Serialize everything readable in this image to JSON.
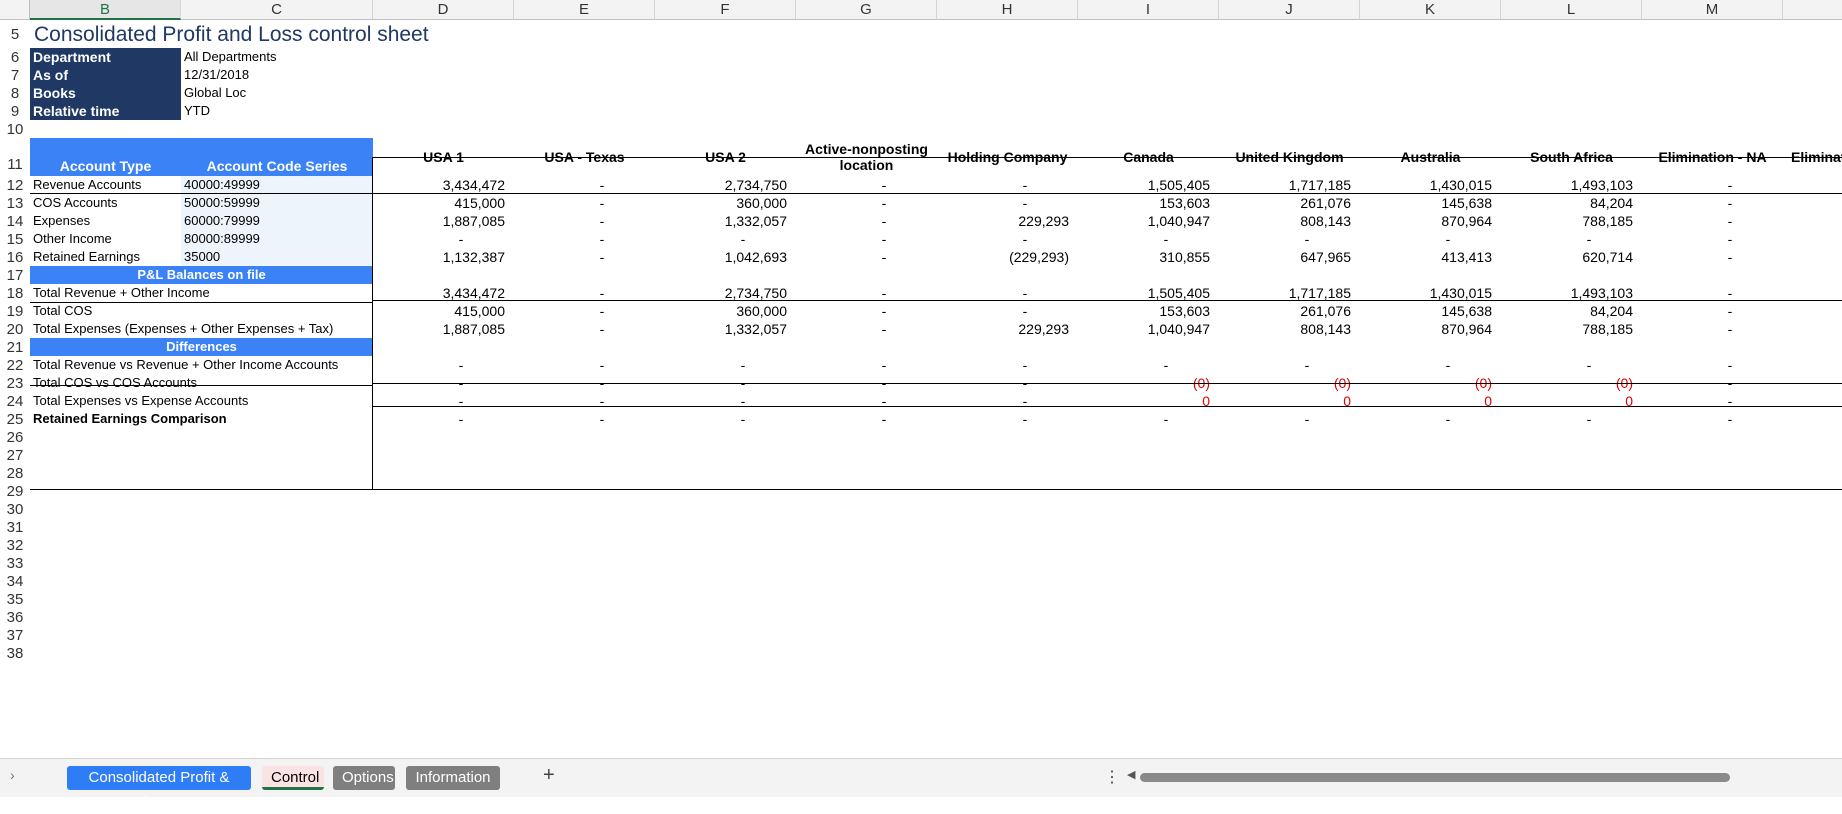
{
  "columns": [
    "B",
    "C",
    "D",
    "E",
    "F",
    "G",
    "H",
    "I",
    "J",
    "K",
    "L",
    "M"
  ],
  "active_column": "B",
  "rows": [
    "5",
    "6",
    "7",
    "8",
    "9",
    "10",
    "11",
    "12",
    "13",
    "14",
    "15",
    "16",
    "17",
    "18",
    "19",
    "20",
    "21",
    "22",
    "23",
    "24",
    "25",
    "26",
    "27",
    "28",
    "29",
    "30",
    "31",
    "32",
    "33",
    "34",
    "35",
    "36",
    "37",
    "38"
  ],
  "title": "Consolidated Profit and Loss control sheet",
  "params": [
    {
      "label": "Department",
      "value": "All Departments"
    },
    {
      "label": "As of",
      "value": "12/31/2018"
    },
    {
      "label": "Books",
      "value": "Global Loc"
    },
    {
      "label": "Relative time",
      "value": "YTD"
    }
  ],
  "headers": {
    "account_type": "Account Type",
    "account_code_series": "Account Code Series"
  },
  "entities": [
    "USA 1",
    "USA - Texas",
    "USA 2",
    "Active-nonposting location",
    "Holding Company",
    "Canada",
    "United Kingdom",
    "Australia",
    "South Africa",
    "Elimination - NA",
    "Eliminat"
  ],
  "accounts": [
    {
      "type": "Revenue Accounts",
      "code": "40000:49999",
      "values": [
        "3,434,472",
        "-",
        "2,734,750",
        "-",
        "-",
        "1,505,405",
        "1,717,185",
        "1,430,015",
        "1,493,103",
        "-"
      ]
    },
    {
      "type": "COS Accounts",
      "code": "50000:59999",
      "values": [
        "415,000",
        "-",
        "360,000",
        "-",
        "-",
        "153,603",
        "261,076",
        "145,638",
        "84,204",
        "-"
      ]
    },
    {
      "type": "Expenses",
      "code": "60000:79999",
      "values": [
        "1,887,085",
        "-",
        "1,332,057",
        "-",
        "229,293",
        "1,040,947",
        "808,143",
        "870,964",
        "788,185",
        "-"
      ]
    },
    {
      "type": "Other Income",
      "code": "80000:89999",
      "values": [
        "-",
        "-",
        "-",
        "-",
        "-",
        "-",
        "-",
        "-",
        "-",
        "-"
      ]
    },
    {
      "type": "Retained Earnings",
      "code": "35000",
      "values": [
        "1,132,387",
        "-",
        "1,042,693",
        "-",
        "(229,293)",
        "310,855",
        "647,965",
        "413,413",
        "620,714",
        "-"
      ]
    }
  ],
  "balances_header": "P&L Balances on file",
  "balances": [
    {
      "label": "Total Revenue + Other Income",
      "values": [
        "3,434,472",
        "-",
        "2,734,750",
        "-",
        "-",
        "1,505,405",
        "1,717,185",
        "1,430,015",
        "1,493,103",
        "-"
      ]
    },
    {
      "label": "Total COS",
      "values": [
        "415,000",
        "-",
        "360,000",
        "-",
        "-",
        "153,603",
        "261,076",
        "145,638",
        "84,204",
        "-"
      ]
    },
    {
      "label": "Total Expenses (Expenses + Other Expenses + Tax)",
      "values": [
        "1,887,085",
        "-",
        "1,332,057",
        "-",
        "229,293",
        "1,040,947",
        "808,143",
        "870,964",
        "788,185",
        "-"
      ]
    }
  ],
  "differences_header": "Differences",
  "differences": [
    {
      "label": "Total Revenue vs Revenue + Other Income Accounts",
      "bold": false,
      "values": [
        "-",
        "-",
        "-",
        "-",
        "-",
        "-",
        "-",
        "-",
        "-",
        "-"
      ]
    },
    {
      "label": "Total COS vs COS Accounts",
      "bold": false,
      "values": [
        "-",
        "-",
        "-",
        "-",
        "-",
        "(0)",
        "(0)",
        "(0)",
        "(0)",
        "-"
      ]
    },
    {
      "label": "Total Expenses vs Expense Accounts",
      "bold": false,
      "values": [
        "-",
        "-",
        "-",
        "-",
        "-",
        "0",
        "0",
        "0",
        "0",
        "-"
      ]
    },
    {
      "label": "Retained Earnings Comparison",
      "bold": true,
      "values": [
        "-",
        "-",
        "-",
        "-",
        "-",
        "-",
        "-",
        "-",
        "-",
        "-"
      ]
    }
  ],
  "sheet_tabs": [
    {
      "label": "Consolidated Profit & Loss",
      "style": "blue"
    },
    {
      "label": "Control",
      "style": "active"
    },
    {
      "label": "Options",
      "style": "gray"
    },
    {
      "label": "Information",
      "style": "gray"
    }
  ],
  "colors": {
    "navy": "#203864",
    "blue": "#3b82f6",
    "red": "#e00000",
    "title": "#1f3864"
  }
}
